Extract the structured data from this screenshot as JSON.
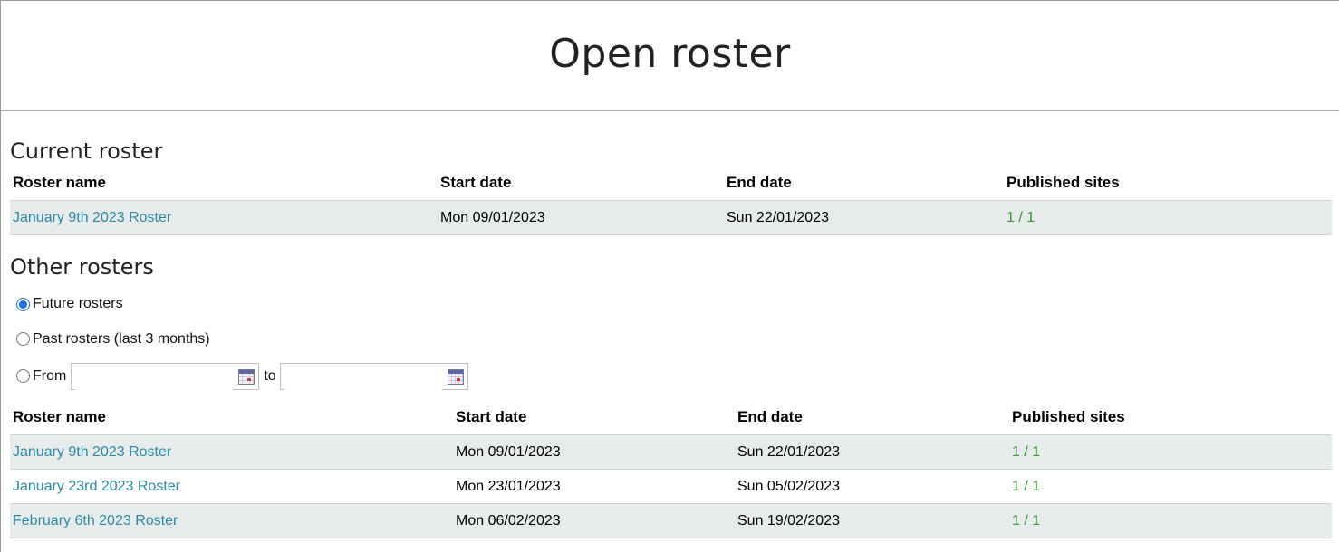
{
  "header": {
    "title": "Open roster"
  },
  "current": {
    "section_title": "Current roster",
    "columns": [
      "Roster name",
      "Start date",
      "End date",
      "Published sites"
    ],
    "rows": [
      {
        "name": "January 9th 2023 Roster",
        "start": "Mon 09/01/2023",
        "end": "Sun 22/01/2023",
        "published": "1 / 1"
      }
    ]
  },
  "other": {
    "section_title": "Other rosters",
    "filters": {
      "future_label": "Future rosters",
      "past_label": "Past rosters (last 3 months)",
      "from_label": "From",
      "to_label": "to",
      "from_value": "",
      "to_value": "",
      "selected": "future"
    },
    "columns": [
      "Roster name",
      "Start date",
      "End date",
      "Published sites"
    ],
    "rows": [
      {
        "name": "January 9th 2023 Roster",
        "start": "Mon 09/01/2023",
        "end": "Sun 22/01/2023",
        "published": "1 / 1"
      },
      {
        "name": "January 23rd 2023 Roster",
        "start": "Mon 23/01/2023",
        "end": "Sun 05/02/2023",
        "published": "1 / 1"
      },
      {
        "name": "February 6th 2023 Roster",
        "start": "Mon 06/02/2023",
        "end": "Sun 19/02/2023",
        "published": "1 / 1"
      }
    ]
  },
  "colors": {
    "link": "#2a8ba5",
    "published": "#2e9b2e",
    "row_shade": "#e8ebeb",
    "radio_accent": "#1a73e8"
  },
  "icons": {
    "date_picker": "calendar-icon"
  }
}
